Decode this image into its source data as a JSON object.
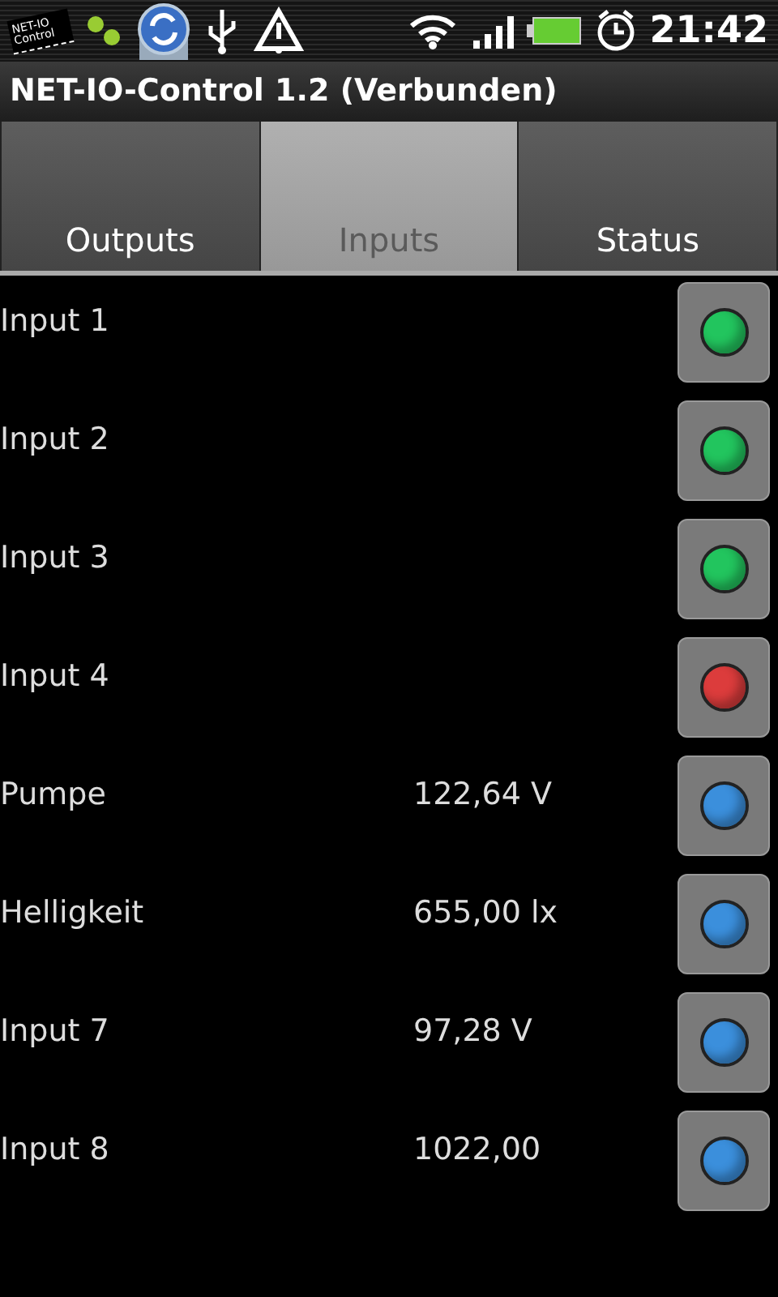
{
  "status_bar": {
    "app_badge": "NET-IO Control",
    "time": "21:42"
  },
  "title": "NET-IO-Control 1.2 (Verbunden)",
  "tabs": [
    {
      "label": "Outputs",
      "selected": false
    },
    {
      "label": "Inputs",
      "selected": true
    },
    {
      "label": "Status",
      "selected": false
    }
  ],
  "inputs": [
    {
      "name": "Input 1",
      "color": "#22c55e"
    },
    {
      "name": "Input 2",
      "color": "#22c55e"
    },
    {
      "name": "Input 3",
      "color": "#22c55e"
    },
    {
      "name": "Input 4",
      "color": "#dc3c3c"
    },
    {
      "name": "Pumpe",
      "value": "122,64 V",
      "color": "#3b8fdc"
    },
    {
      "name": "Helligkeit",
      "value": "655,00 lx",
      "color": "#3b8fdc"
    },
    {
      "name": "Input 7",
      "value": "97,28 V",
      "color": "#3b8fdc"
    },
    {
      "name": "Input 8",
      "value": "1022,00",
      "color": "#3b8fdc"
    }
  ]
}
